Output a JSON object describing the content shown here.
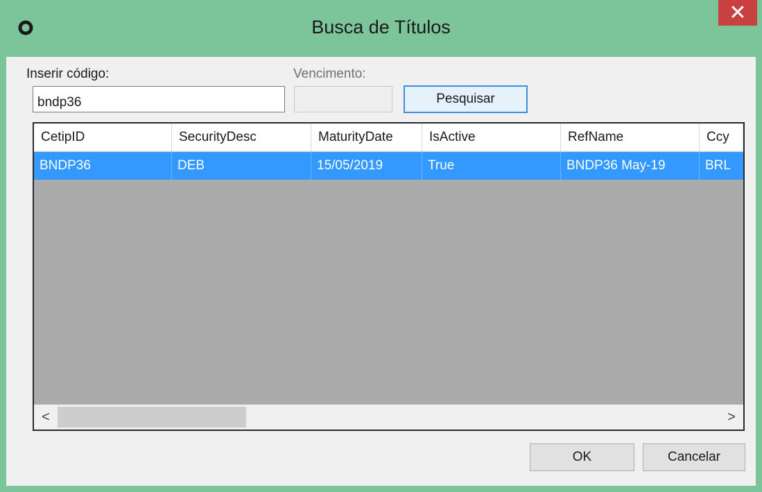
{
  "window": {
    "title": "Busca de Títulos",
    "close_label": "✕"
  },
  "form": {
    "code_label": "Inserir código:",
    "code_value": "bndp36",
    "maturity_label": "Vencimento:",
    "maturity_value": "",
    "search_button": "Pesquisar"
  },
  "grid": {
    "columns": [
      "CetipID",
      "SecurityDesc",
      "MaturityDate",
      "IsActive",
      "RefName",
      "Ccy"
    ],
    "rows": [
      {
        "selected": true,
        "cells": [
          "BNDP36",
          "DEB",
          "15/05/2019",
          "True",
          "BNDP36 May-19",
          "BRL"
        ]
      }
    ],
    "scroll_left": "<",
    "scroll_right": ">"
  },
  "footer": {
    "ok_button": "OK",
    "cancel_button": "Cancelar"
  },
  "colors": {
    "titlebar": "#7cc59a",
    "close": "#c94040",
    "selection": "#3399ff",
    "grid_background": "#ababab"
  },
  "icons": {
    "app": "circle-ring-icon",
    "close": "close-icon"
  }
}
